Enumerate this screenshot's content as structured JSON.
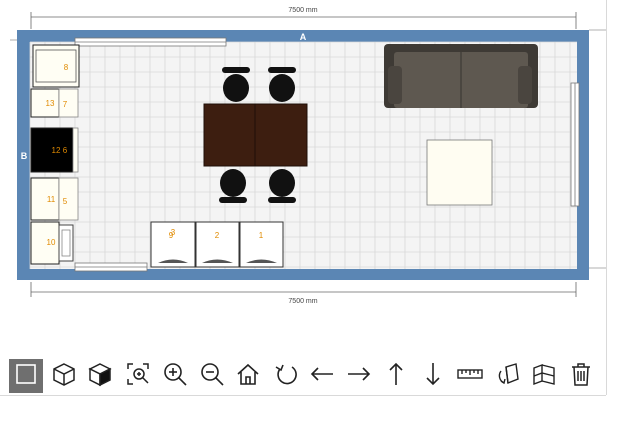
{
  "plan": {
    "dimension_top": "7500 mm",
    "dimension_bottom": "7500 mm",
    "wall_top_label": "A",
    "wall_left_label": "B",
    "item_labels": {
      "cab_8": "8",
      "cab_13": "13",
      "cab_7": "7",
      "cab_12": "12",
      "cab_6": "6",
      "cab_11": "11",
      "cab_5": "5",
      "cab_10": "10",
      "unit_3": "3",
      "unit_9": "9",
      "unit_2": "2",
      "unit_1": "1"
    },
    "colors": {
      "wall": "#5b86b4",
      "floor": "#f4f4f4",
      "grid": "#d8d8d8",
      "table": "#3d1e10",
      "sofa": "#5e5850",
      "label": "#e08a00"
    }
  },
  "toolbar": {
    "tools": [
      {
        "name": "select-tool",
        "icon": "square-select-icon",
        "active": true
      },
      {
        "name": "3d-wire-view",
        "icon": "cube-outline-icon"
      },
      {
        "name": "3d-solid-view",
        "icon": "cube-solid-icon"
      },
      {
        "name": "zoom-fit",
        "icon": "zoom-fit-icon"
      },
      {
        "name": "zoom-in",
        "icon": "zoom-in-icon"
      },
      {
        "name": "zoom-out",
        "icon": "zoom-out-icon"
      },
      {
        "name": "home-view",
        "icon": "home-icon"
      },
      {
        "name": "rotate",
        "icon": "rotate-icon"
      },
      {
        "name": "move-left",
        "icon": "arrow-left-icon"
      },
      {
        "name": "move-right",
        "icon": "arrow-right-icon"
      },
      {
        "name": "move-up",
        "icon": "arrow-up-icon"
      },
      {
        "name": "move-down",
        "icon": "arrow-down-icon"
      },
      {
        "name": "measure",
        "icon": "ruler-icon"
      },
      {
        "name": "rotate-3d",
        "icon": "rotate-box-icon"
      },
      {
        "name": "walls-view",
        "icon": "walls-icon"
      },
      {
        "name": "delete",
        "icon": "trash-icon"
      }
    ]
  }
}
